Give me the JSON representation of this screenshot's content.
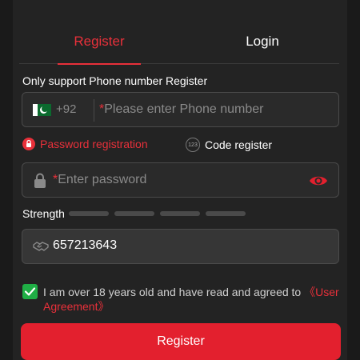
{
  "tabs": {
    "register": "Register",
    "login": "Login"
  },
  "hint": "Only support Phone number Register",
  "phone": {
    "country_code": "+92",
    "required_mark": "*",
    "placeholder": "Please enter Phone number",
    "flag_icon": "pakistan-flag-icon"
  },
  "methods": {
    "password": "Password registration",
    "code": "Code register",
    "code_badge": "123"
  },
  "password": {
    "required_mark": "*",
    "placeholder": "Enter password"
  },
  "strength": {
    "label": "Strength",
    "level": 0,
    "segments": 4
  },
  "captcha": {
    "value": "657213643"
  },
  "agreement": {
    "checked": true,
    "text": "I am over 18 years old and have read and agreed to ",
    "link": "《User Agreement》"
  },
  "submit_label": "Register",
  "colors": {
    "accent": "#e3202e",
    "checkbox": "#1fae45",
    "background": "#232323"
  }
}
